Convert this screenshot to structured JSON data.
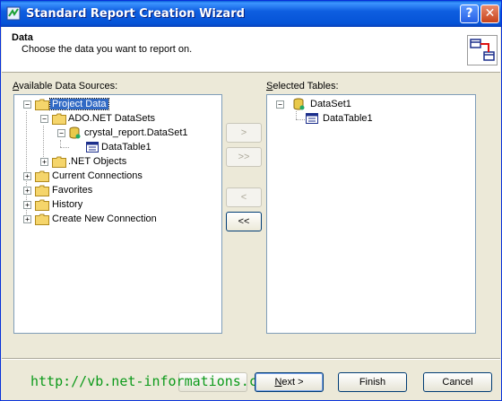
{
  "window": {
    "title": "Standard Report Creation Wizard",
    "help_glyph": "?",
    "close_glyph": "✕"
  },
  "header": {
    "title": "Data",
    "subtitle": "Choose the data you want to report on."
  },
  "available": {
    "label_access_key": "A",
    "label_rest": "vailable Data Sources:",
    "tree": {
      "project_data": "Project Data",
      "ado_net": "ADO.NET DataSets",
      "dataset": "crystal_report.DataSet1",
      "datatable": "DataTable1",
      "net_objects": ".NET Objects",
      "current_connections": "Current Connections",
      "favorites": "Favorites",
      "history": "History",
      "create_new": "Create New Connection"
    }
  },
  "selected": {
    "label_access_key": "S",
    "label_rest": "elected Tables:",
    "tree": {
      "dataset": "DataSet1",
      "datatable": "DataTable1"
    }
  },
  "move_buttons": {
    "add_one": ">",
    "add_all": ">>",
    "remove_one": "<",
    "remove_all": "<<"
  },
  "footer": {
    "watermark": "http://vb.net-informations.com",
    "next_access_key": "N",
    "next_rest": "ext >",
    "finish": "Finish",
    "cancel": "Cancel"
  },
  "colors": {
    "titlebar": "#0553d6",
    "selection": "#316ac5",
    "watermark": "#0c9a1a",
    "dialog": "#ece9d8"
  }
}
